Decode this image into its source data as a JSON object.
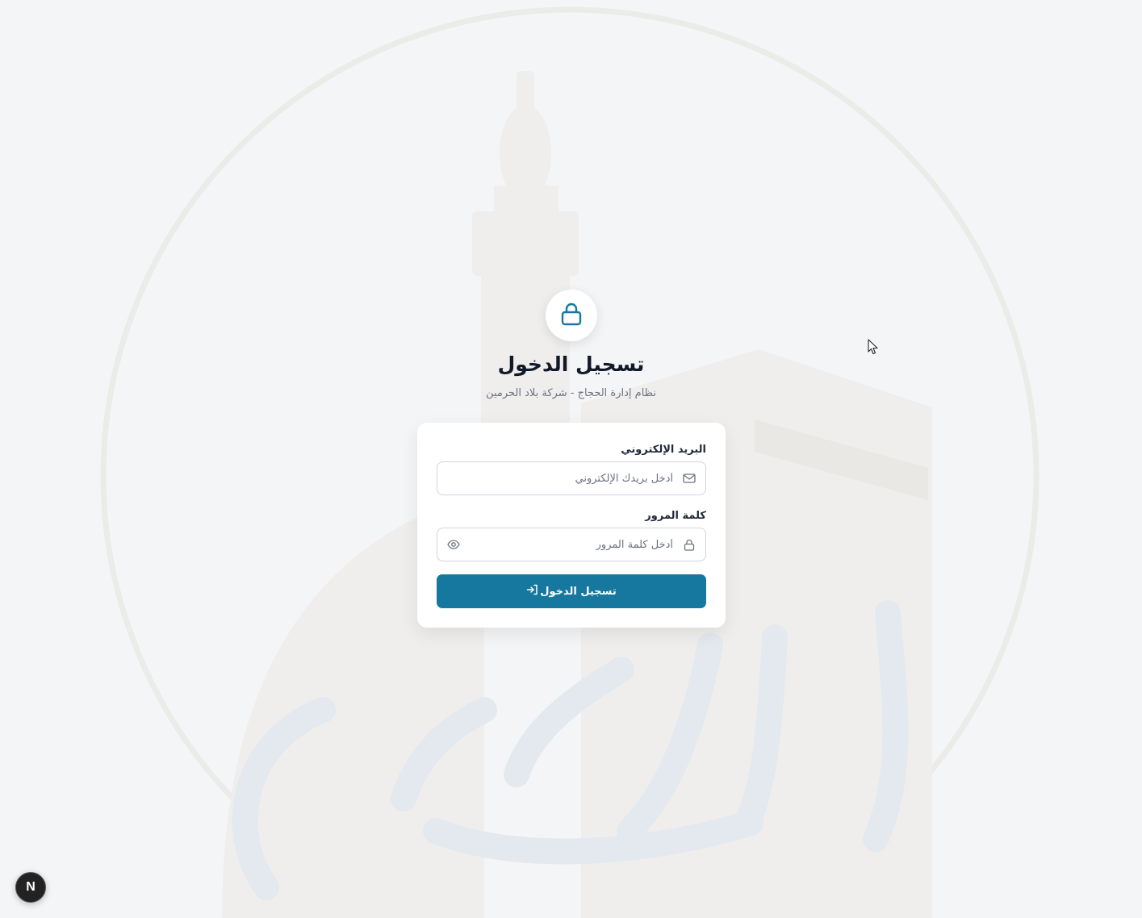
{
  "header": {
    "title": "تسجيل الدخول",
    "subtitle": "نظام إدارة الحجاج - شركة بلاد الحرمين",
    "icon": "lock-icon"
  },
  "form": {
    "email": {
      "label": "البريد الإلكتروني",
      "placeholder": "أدخل بريدك الإلكتروني",
      "value": "",
      "icon": "mail-icon"
    },
    "password": {
      "label": "كلمة المرور",
      "placeholder": "أدخل كلمة المرور",
      "value": "",
      "icon": "lock-icon",
      "toggle_icon": "eye-icon"
    },
    "submit_label": "تسجيل الدخول",
    "submit_icon": "login-icon"
  },
  "dev_badge": {
    "label": "N"
  },
  "colors": {
    "primary": "#16789e",
    "background": "#f4f5f6",
    "card": "#ffffff",
    "title": "#111827",
    "muted": "#6b7280",
    "border": "#d1d5db"
  }
}
